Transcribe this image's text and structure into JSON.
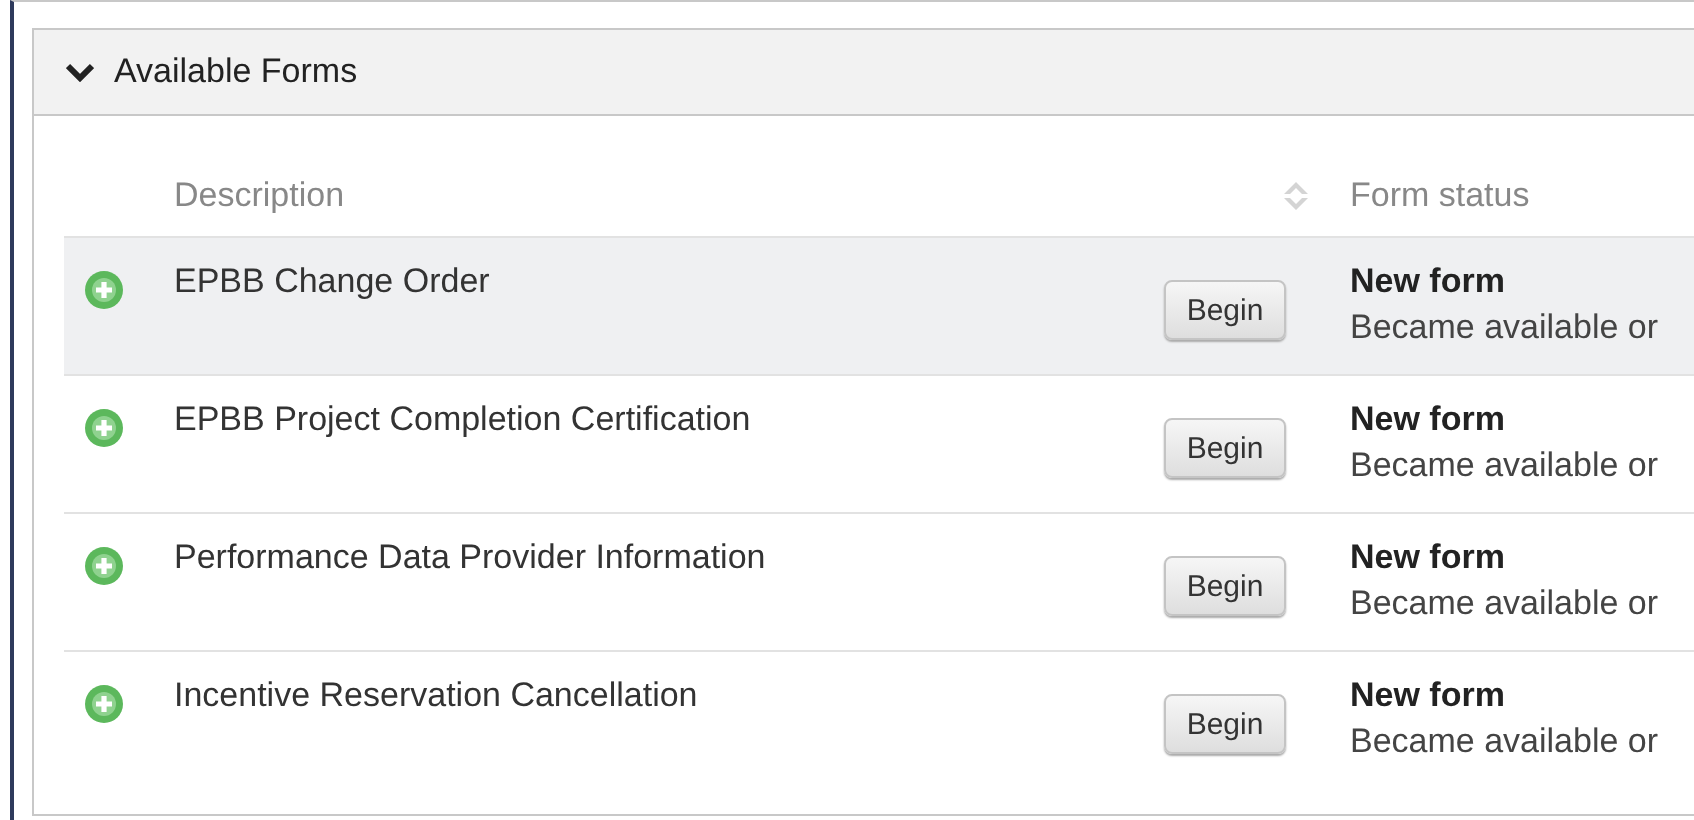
{
  "panel": {
    "title": "Available Forms",
    "expanded": true
  },
  "table": {
    "columns": [
      "Description",
      "Form status"
    ],
    "rows": [
      {
        "description": "EPBB Change Order",
        "action": "Begin",
        "status": "New form",
        "detail": "Became available or",
        "highlighted": true
      },
      {
        "description": "EPBB Project Completion Certification",
        "action": "Begin",
        "status": "New form",
        "detail": "Became available or",
        "highlighted": false
      },
      {
        "description": "Performance Data Provider Information",
        "action": "Begin",
        "status": "New form",
        "detail": "Became available or",
        "highlighted": false
      },
      {
        "description": "Incentive Reservation Cancellation",
        "action": "Begin",
        "status": "New form",
        "detail": "Became available or",
        "highlighted": false
      }
    ]
  }
}
